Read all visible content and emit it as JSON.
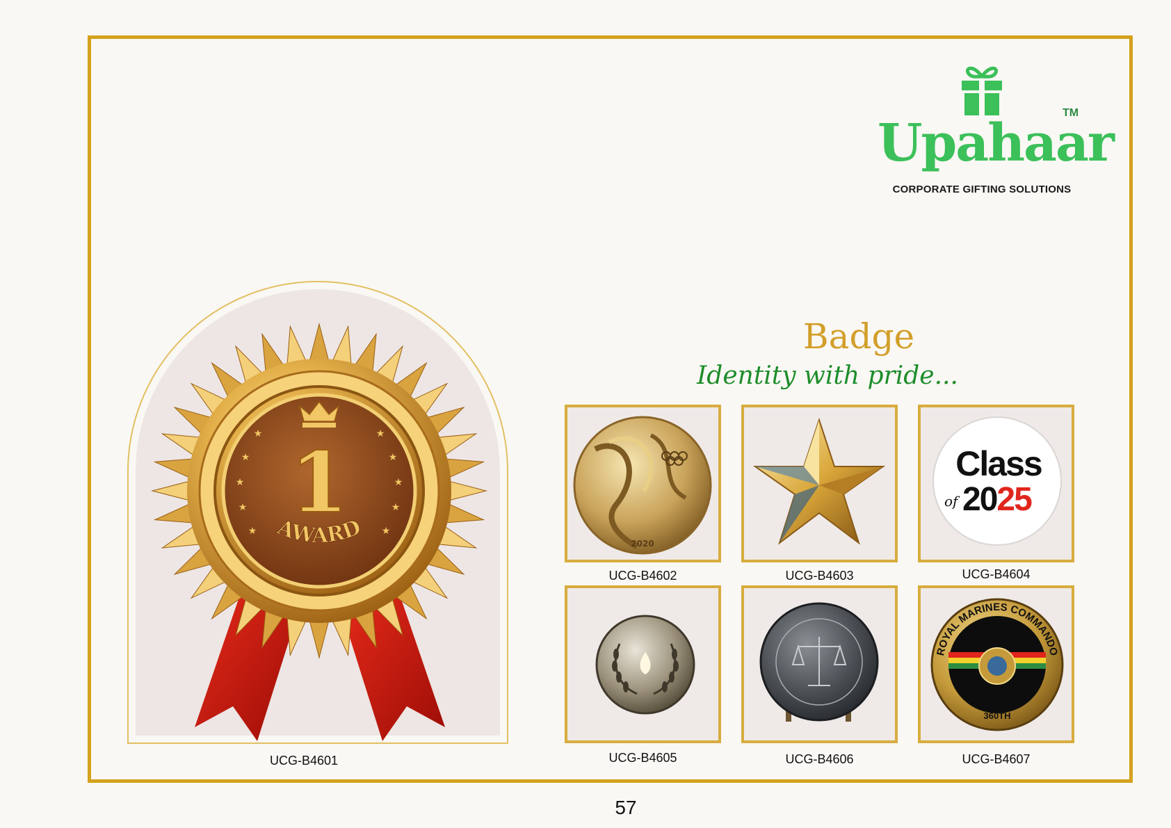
{
  "brand": {
    "name": "Upahaar",
    "trademark": "TM",
    "tagline": "CORPORATE GIFTING SOLUTIONS",
    "color": "#3cc05a"
  },
  "section": {
    "title": "Badge",
    "subtitle": "Identity with pride..."
  },
  "featured": {
    "code": "UCG-B4601",
    "medal_number": "1",
    "medal_text": "AWARD"
  },
  "products": [
    {
      "code": "UCG-B4602",
      "icon": "olympic-medal-icon"
    },
    {
      "code": "UCG-B4603",
      "icon": "gold-star-icon"
    },
    {
      "code": "UCG-B4604",
      "icon": "class-of-2025-button-icon",
      "text_line1": "Class",
      "text_of": "of",
      "text_year_a": "20",
      "text_year_b": "25"
    },
    {
      "code": "UCG-B4605",
      "icon": "laurel-flame-coin-icon"
    },
    {
      "code": "UCG-B4606",
      "icon": "scales-of-justice-coin-icon"
    },
    {
      "code": "UCG-B4607",
      "icon": "royal-marines-coin-icon",
      "text_top": "ROYAL MARINES COMMANDO",
      "text_bottom": "360TH"
    }
  ],
  "page_number": "57",
  "colors": {
    "frame": "#d4a21c",
    "title": "#d29f2a",
    "subtitle": "#1d8d2b",
    "tile_border": "#d8ac3e"
  }
}
